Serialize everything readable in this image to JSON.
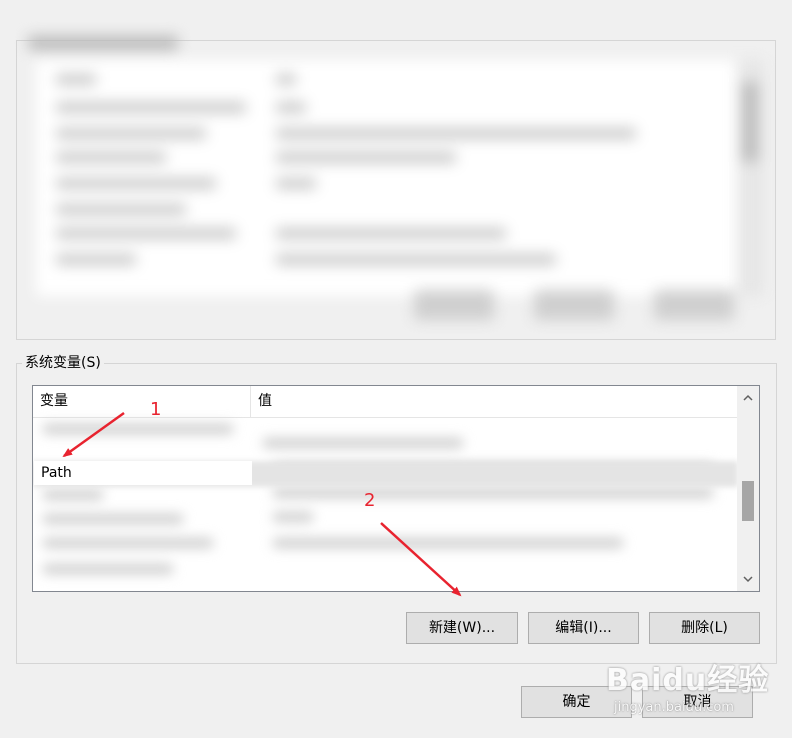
{
  "system_variables": {
    "group_label": "系统变量(S)",
    "columns": {
      "variable": "变量",
      "value": "值"
    },
    "selected_row": {
      "variable": "Path"
    }
  },
  "buttons": {
    "new": "新建(W)...",
    "edit": "编辑(I)...",
    "delete": "删除(L)",
    "ok": "确定",
    "cancel": "取消"
  },
  "annotations": {
    "step1": "1",
    "step2": "2",
    "color": "#e8232f"
  },
  "watermark": {
    "brand": "Baidu经验",
    "url": "jingyan.baidu.com"
  },
  "icons": {
    "scroll_up": "chevron-up-icon",
    "scroll_down": "chevron-down-icon",
    "arrow": "red-annotation-arrow"
  }
}
